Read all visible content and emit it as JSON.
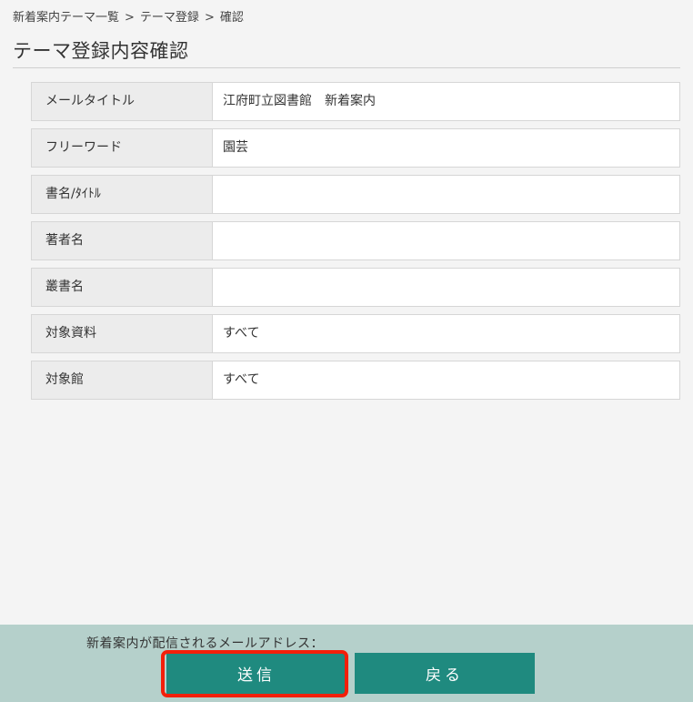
{
  "breadcrumb": {
    "items": [
      "新着案内テーマ一覧",
      "テーマ登録",
      "確認"
    ],
    "separator": ">"
  },
  "page_title": "テーマ登録内容確認",
  "rows": [
    {
      "label": "メールタイトル",
      "value": "江府町立図書館　新着案内"
    },
    {
      "label": "フリーワード",
      "value": "園芸"
    },
    {
      "label": "書名/ﾀｲﾄﾙ",
      "value": ""
    },
    {
      "label": "著者名",
      "value": ""
    },
    {
      "label": "叢書名",
      "value": ""
    },
    {
      "label": "対象資料",
      "value": "すべて"
    },
    {
      "label": "対象館",
      "value": "すべて"
    }
  ],
  "footer": {
    "notice": "新着案内が配信されるメールアドレス：",
    "send_label": "送信",
    "back_label": "戻る"
  },
  "colors": {
    "button": "#1f8a7f",
    "footer_bg": "#b5d0cb",
    "highlight": "#f21f0a"
  }
}
